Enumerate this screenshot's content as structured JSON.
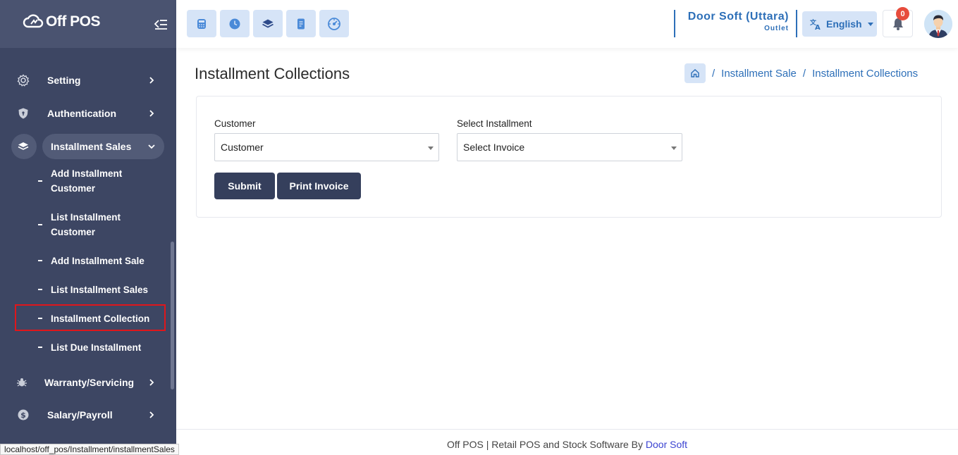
{
  "app": {
    "brand": "Off POS"
  },
  "sidebar": {
    "items": [
      {
        "label": "Setting",
        "icon": "gear-icon"
      },
      {
        "label": "Authentication",
        "icon": "shield-icon"
      },
      {
        "label": "Installment Sales",
        "icon": "layers-icon",
        "expanded": true
      },
      {
        "label": "Warranty/Servicing",
        "icon": "bug-icon"
      },
      {
        "label": "Salary/Payroll",
        "icon": "dollar-icon"
      }
    ],
    "sub_items": [
      {
        "label": "Add Installment Customer"
      },
      {
        "label": "List Installment Customer"
      },
      {
        "label": "Add Installment Sale"
      },
      {
        "label": "List Installment Sales"
      },
      {
        "label": "Installment Collection",
        "active": true
      },
      {
        "label": "List Due Installment"
      }
    ]
  },
  "header": {
    "quick_buttons": [
      "calculator-icon",
      "clock-icon",
      "layers-icon",
      "document-icon",
      "dashboard-icon"
    ],
    "outlet_name": "Door Soft (Uttara)",
    "outlet_sub": "Outlet",
    "language": "English",
    "notification_count": "0"
  },
  "page": {
    "title": "Installment Collections",
    "breadcrumb": [
      "Installment Sale",
      "Installment Collections"
    ]
  },
  "form": {
    "customer_label": "Customer",
    "customer_value": "Customer",
    "installment_label": "Select Installment",
    "installment_value": "Select Invoice",
    "submit_label": "Submit",
    "print_label": "Print Invoice"
  },
  "footer": {
    "text": "Off POS | Retail POS and Stock Software By ",
    "link": "Door Soft"
  },
  "status_bar": {
    "url": "localhost/off_pos/Installment/installmentSales"
  },
  "colors": {
    "sidebar": "#3d4663",
    "accent": "#2d6fb8",
    "button_dark": "#353f5c",
    "badge": "#e74c3c"
  }
}
